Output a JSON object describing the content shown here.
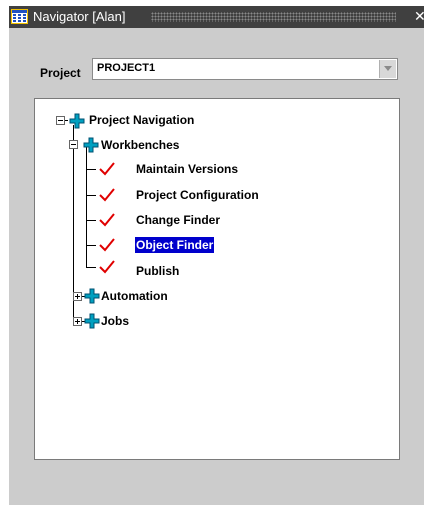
{
  "window": {
    "title": "Navigator [Alan]",
    "close_glyph": "✕"
  },
  "project": {
    "label": "Project",
    "value": "PROJECT1"
  },
  "tree": {
    "root": "Project Navigation",
    "workbenches": "Workbenches",
    "items": [
      "Maintain Versions",
      "Project Configuration",
      "Change Finder",
      "Object Finder",
      "Publish"
    ],
    "selected_item": "Object Finder",
    "automation": "Automation",
    "jobs": "Jobs"
  },
  "colors": {
    "selection": "#0000cc",
    "check": "#e00000",
    "plus_icon": "#00a0c0",
    "titlebar": "#404040"
  },
  "icons": {
    "folder": "cross-plus-icon",
    "leaf": "checkmark-icon",
    "window": "grid-app-icon"
  }
}
